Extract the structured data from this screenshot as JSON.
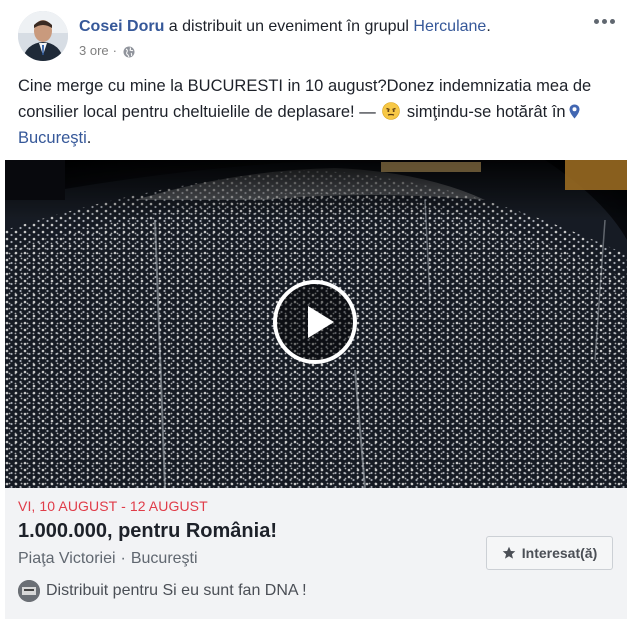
{
  "post": {
    "author": "Cosei Doru",
    "action": "a distribuit un eveniment în grupul",
    "group": "Herculane",
    "time": "3 ore",
    "separator": "·",
    "text_line1": "Cine merge cu mine la BUCURESTI in 10 august?Donez indemnizatia mea de consilier local pentru cheltuielile de deplasare! —",
    "feeling": "simţindu-se hotărât",
    "in_label": "în",
    "location_link": "Bucureşti",
    "location_end": "."
  },
  "event": {
    "date": "VI, 10 AUGUST - 12 AUGUST",
    "title": "1.000.000, pentru România!",
    "place": "Piaţa Victoriei",
    "dot": "·",
    "city": "Bucureşti",
    "interested_label": "Interesat(ă)",
    "shared_for": "Distribuit pentru Si eu sunt fan DNA !"
  },
  "icons": {
    "globe": "globe-icon",
    "more": "more-options-icon",
    "play": "play-icon",
    "star": "star-icon",
    "pin": "location-pin-icon",
    "emoji": "determined-face-emoji"
  },
  "colors": {
    "link": "#365899",
    "event_date": "#e03c49",
    "event_bg": "#f2f3f5"
  }
}
